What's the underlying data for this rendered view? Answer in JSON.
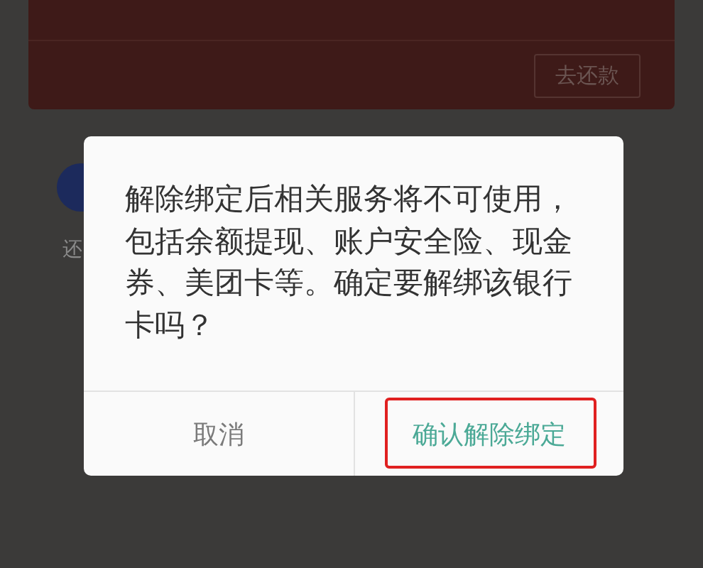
{
  "background": {
    "repay_button": "去还款",
    "side_label": "还"
  },
  "dialog": {
    "message": "解除绑定后相关服务将不可使用，包括余额提现、账户安全险、现金券、美团卡等。确定要解绑该银行卡吗？",
    "buttons": [
      {
        "label": "取消",
        "kind": "cancel",
        "highlighted": false
      },
      {
        "label": "确认解除绑定",
        "kind": "confirm",
        "highlighted": true
      }
    ]
  }
}
